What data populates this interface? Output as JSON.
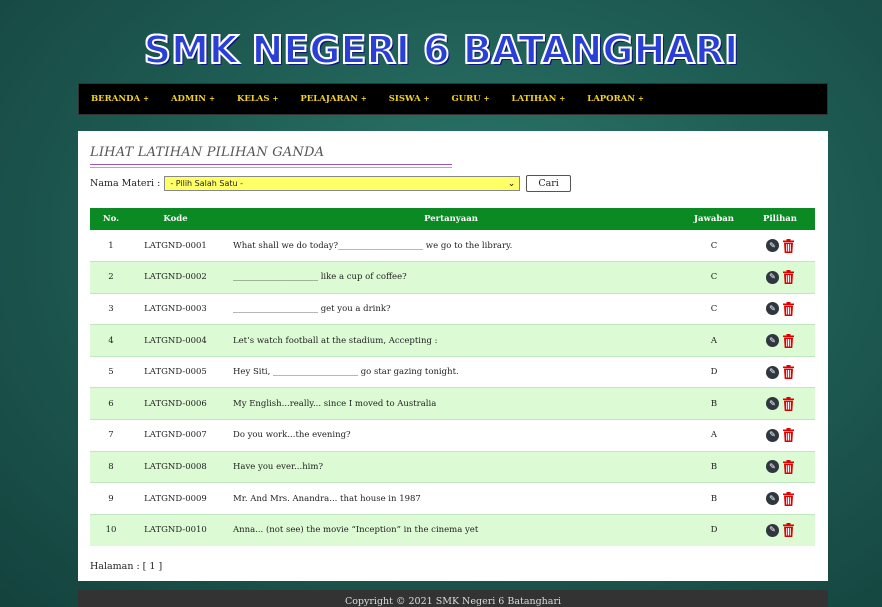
{
  "header": {
    "school_name": "SMK NEGERI 6 BATANGHARI"
  },
  "nav": {
    "items": [
      {
        "label": "BERANDA"
      },
      {
        "label": "ADMIN"
      },
      {
        "label": "KELAS"
      },
      {
        "label": "PELAJARAN"
      },
      {
        "label": "SISWA"
      },
      {
        "label": "GURU"
      },
      {
        "label": "LATIHAN"
      },
      {
        "label": "LAPORAN"
      }
    ],
    "caret": "+"
  },
  "page": {
    "title": "LIHAT LATIHAN PILIHAN GANDA"
  },
  "filter": {
    "label": "Nama Materi :",
    "selected": "- Pilih Salah Satu -",
    "button_label": "Cari"
  },
  "table": {
    "headers": [
      "No.",
      "Kode",
      "Pertanyaan",
      "Jawaban",
      "Pilihan"
    ],
    "rows": [
      {
        "no": "1",
        "kode": "LATGND-0001",
        "q": "What shall we do today?____________________ we go to the library.",
        "j": "C"
      },
      {
        "no": "2",
        "kode": "LATGND-0002",
        "q": "____________________ like a cup of coffee?",
        "j": "C"
      },
      {
        "no": "3",
        "kode": "LATGND-0003",
        "q": "____________________ get you a drink?",
        "j": "C"
      },
      {
        "no": "4",
        "kode": "LATGND-0004",
        "q": "Let’s watch football at the stadium, Accepting :",
        "j": "A"
      },
      {
        "no": "5",
        "kode": "LATGND-0005",
        "q": "Hey Siti, ____________________ go star gazing tonight.",
        "j": "D"
      },
      {
        "no": "6",
        "kode": "LATGND-0006",
        "q": "My English...really... since I moved to Australia",
        "j": "B"
      },
      {
        "no": "7",
        "kode": "LATGND-0007",
        "q": "Do you work...the evening?",
        "j": "A"
      },
      {
        "no": "8",
        "kode": "LATGND-0008",
        "q": "Have you ever...him?",
        "j": "B"
      },
      {
        "no": "9",
        "kode": "LATGND-0009",
        "q": "Mr. And Mrs. Anandra... that house in 1987",
        "j": "B"
      },
      {
        "no": "10",
        "kode": "LATGND-0010",
        "q": "Anna... (not see) the movie “Inception” in the cinema yet",
        "j": "D"
      }
    ]
  },
  "pager": {
    "text": "Halaman : [ 1 ]"
  },
  "footer": {
    "text": "Copyright © 2021 SMK Negeri 6 Batanghari"
  },
  "icons": {
    "edit": "edit-icon",
    "delete": "trash-icon"
  },
  "colors": {
    "nav_text": "#f2d31f",
    "table_header": "#0b8a24",
    "row_alt": "#dcfad4",
    "select_bg": "#ffff66"
  }
}
